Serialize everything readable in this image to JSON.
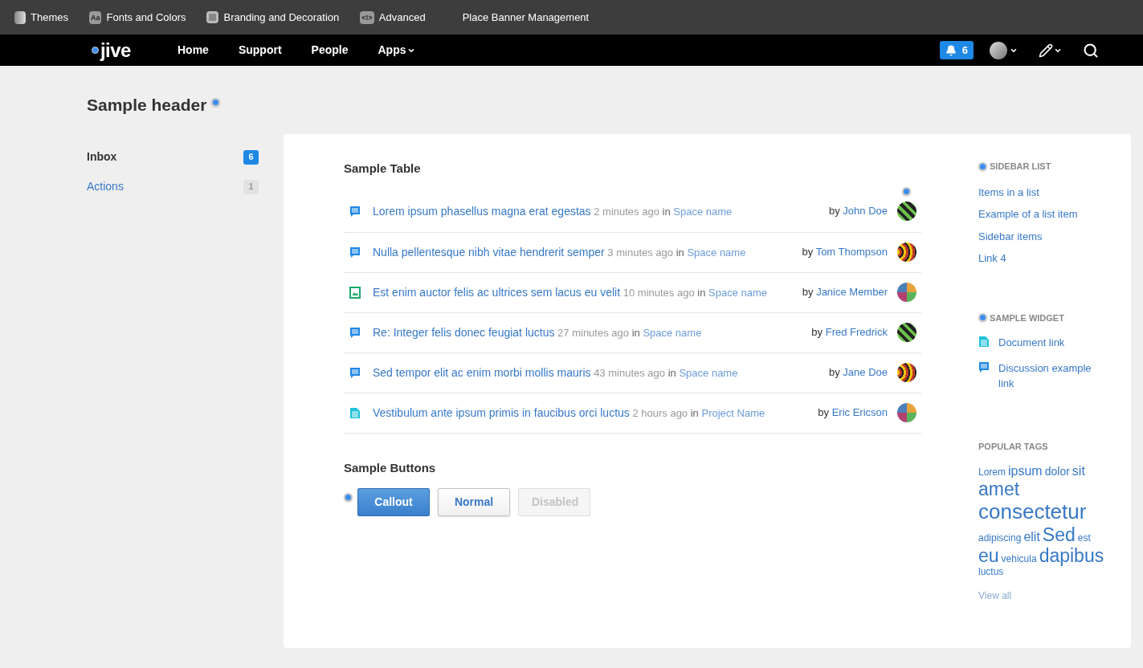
{
  "admin_bar": [
    {
      "label": "Themes",
      "kind": "themes"
    },
    {
      "label": "Fonts and Colors",
      "kind": "fonts",
      "icon_text": "Aa"
    },
    {
      "label": "Branding and Decoration",
      "kind": "branding"
    },
    {
      "label": "Advanced",
      "kind": "advanced",
      "icon_text": "<!>"
    },
    {
      "label": "Place Banner Management",
      "kind": "plain"
    }
  ],
  "nav": {
    "logo": "jive",
    "items": [
      {
        "label": "Home",
        "dropdown": false
      },
      {
        "label": "Support",
        "dropdown": false
      },
      {
        "label": "People",
        "dropdown": false
      },
      {
        "label": "Apps",
        "dropdown": true
      }
    ],
    "notifications": "6"
  },
  "page_title": "Sample header",
  "side_nav": [
    {
      "label": "Inbox",
      "count": "6",
      "selected": true
    },
    {
      "label": "Actions",
      "count": "1",
      "selected": false
    }
  ],
  "table": {
    "title": "Sample Table",
    "rows": [
      {
        "kind": "discussion",
        "title": "Lorem ipsum phasellus magna erat egestas",
        "time": "2 minutes ago",
        "in": "in",
        "place": "Space name",
        "by": "by",
        "author": "John Doe",
        "avatar": {
          "kind": "stripes"
        }
      },
      {
        "kind": "discussion",
        "title": "Nulla pellentesque nibh vitae hendrerit semper",
        "time": "3 minutes ago",
        "in": "in",
        "place": "Space name",
        "by": "by",
        "author": "Tom Thompson",
        "avatar": {
          "kind": "rings"
        }
      },
      {
        "kind": "image",
        "title": "Est enim auctor felis ac ultrices sem lacus eu velit",
        "time": "10 minutes ago",
        "in": "in",
        "place": "Space name",
        "by": "by",
        "author": "Janice Member",
        "avatar": {
          "kind": "grid"
        }
      },
      {
        "kind": "discussion",
        "title": "Re: Integer felis donec feugiat luctus",
        "time": "27 minutes ago",
        "in": "in",
        "place": "Space name",
        "by": "by",
        "author": "Fred Fredrick",
        "avatar": {
          "kind": "stripes"
        }
      },
      {
        "kind": "discussion",
        "title": "Sed tempor elit ac enim morbi mollis mauris",
        "time": "43 minutes ago",
        "in": "in",
        "place": "Space name",
        "by": "by",
        "author": "Jane Doe",
        "avatar": {
          "kind": "rings"
        }
      },
      {
        "kind": "document",
        "title": "Vestibulum ante ipsum primis in faucibus orci luctus",
        "time": "2 hours ago",
        "in": "in",
        "place": "Project Name",
        "by": "by",
        "author": "Eric Ericson",
        "avatar": {
          "kind": "grid"
        }
      }
    ]
  },
  "buttons_section": {
    "title": "Sample Buttons",
    "buttons": [
      {
        "label": "Callout",
        "kind": "callout",
        "disabled": false
      },
      {
        "label": "Normal",
        "kind": "normal",
        "disabled": false
      },
      {
        "label": "Disabled",
        "kind": "normal",
        "disabled": true
      }
    ]
  },
  "sidebar_list": {
    "title": "SIDEBAR LIST",
    "items": [
      "Items in a list",
      "Example of a list item",
      "Sidebar items",
      "Link 4"
    ]
  },
  "sample_widget": {
    "title": "SAMPLE WIDGET",
    "items": [
      {
        "kind": "document",
        "label": "Document link"
      },
      {
        "kind": "discussion",
        "label": "Discussion example link"
      }
    ]
  },
  "popular_tags": {
    "title": "POPULAR TAGS",
    "tags": [
      {
        "label": "Lorem",
        "kind": "xs"
      },
      {
        "label": "ipsum",
        "kind": "m"
      },
      {
        "label": "dolor",
        "kind": "s"
      },
      {
        "label": "sit",
        "kind": "m"
      },
      {
        "label": "amet",
        "kind": "l"
      },
      {
        "label": "consectetur",
        "kind": "xl"
      },
      {
        "label": "adipiscing",
        "kind": "xs"
      },
      {
        "label": "elit",
        "kind": "m"
      },
      {
        "label": "Sed",
        "kind": "l"
      },
      {
        "label": "est",
        "kind": "xs"
      },
      {
        "label": "eu",
        "kind": "l"
      },
      {
        "label": "vehicula",
        "kind": "xs"
      },
      {
        "label": "dapibus",
        "kind": "l"
      },
      {
        "label": "luctus",
        "kind": "xs"
      }
    ],
    "view_all": "View all"
  }
}
